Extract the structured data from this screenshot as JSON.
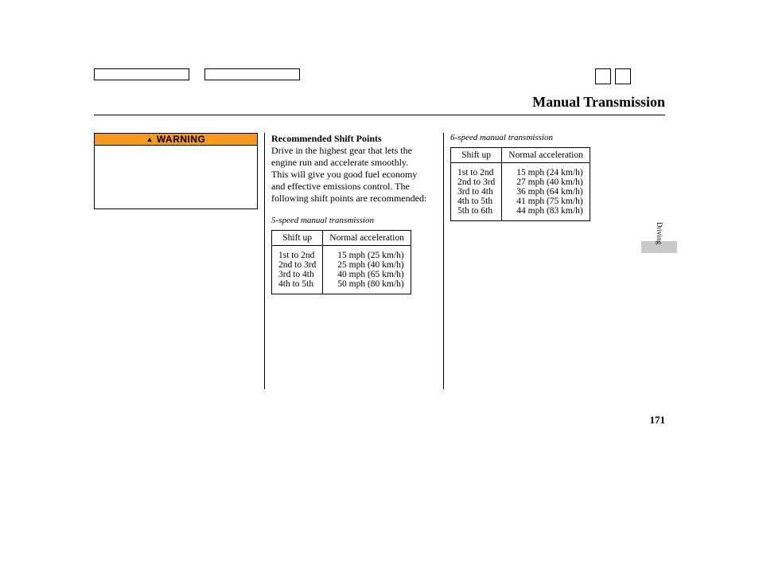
{
  "page_title": "Manual Transmission",
  "warning_label": "WARNING",
  "section_tab": "Driving",
  "page_number": "171",
  "col2": {
    "heading": "Recommended Shift Points",
    "paragraph": "Drive in the highest gear that lets the engine run and accelerate smoothly. This will give you good fuel economy and effective emissions control. The following shift points are recommended:",
    "caption": "5-speed manual transmission",
    "table_header_left": "Shift up",
    "table_header_right": "Normal acceleration",
    "rows": [
      {
        "shift": "1st to 2nd",
        "accel": "15 mph (25 km/h)"
      },
      {
        "shift": "2nd to 3rd",
        "accel": "25 mph (40 km/h)"
      },
      {
        "shift": "3rd to 4th",
        "accel": "40 mph (65 km/h)"
      },
      {
        "shift": "4th to 5th",
        "accel": "50 mph (80 km/h)"
      }
    ]
  },
  "col3": {
    "caption": "6-speed manual transmission",
    "table_header_left": "Shift up",
    "table_header_right": "Normal acceleration",
    "rows": [
      {
        "shift": "1st to 2nd",
        "accel": "15 mph (24 km/h)"
      },
      {
        "shift": "2nd to 3rd",
        "accel": "27 mph (40 km/h)"
      },
      {
        "shift": "3rd to 4th",
        "accel": "36 mph (64 km/h)"
      },
      {
        "shift": "4th to 5th",
        "accel": "41 mph (75 km/h)"
      },
      {
        "shift": "5th to 6th",
        "accel": "44 mph (83 km/h)"
      }
    ]
  },
  "chart_data": [
    {
      "type": "table",
      "title": "5-speed manual transmission — Recommended Shift Points",
      "columns": [
        "Shift up",
        "Normal acceleration (mph)",
        "Normal acceleration (km/h)"
      ],
      "rows": [
        [
          "1st to 2nd",
          15,
          25
        ],
        [
          "2nd to 3rd",
          25,
          40
        ],
        [
          "3rd to 4th",
          40,
          65
        ],
        [
          "4th to 5th",
          50,
          80
        ]
      ]
    },
    {
      "type": "table",
      "title": "6-speed manual transmission — Recommended Shift Points",
      "columns": [
        "Shift up",
        "Normal acceleration (mph)",
        "Normal acceleration (km/h)"
      ],
      "rows": [
        [
          "1st to 2nd",
          15,
          24
        ],
        [
          "2nd to 3rd",
          27,
          40
        ],
        [
          "3rd to 4th",
          36,
          64
        ],
        [
          "4th to 5th",
          41,
          75
        ],
        [
          "5th to 6th",
          44,
          83
        ]
      ]
    }
  ]
}
